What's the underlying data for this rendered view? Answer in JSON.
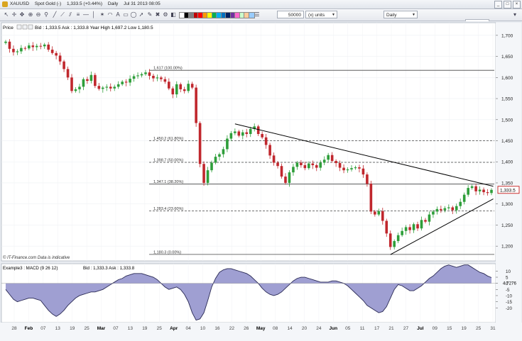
{
  "header": {
    "symbol": "XAUUSD",
    "name": "Spot Gold (-)",
    "price": "1,333.5 (+0.44%)",
    "period": "Daily",
    "datetime": "Jul 31 2013 08:05"
  },
  "toolbar": {
    "quantity": "50000",
    "units": "(x) units",
    "timeframe": "Daily",
    "swatch_colors": [
      "#ffffff",
      "#000000",
      "#7f7f7f",
      "#c00000",
      "#ff0000",
      "#ff9900",
      "#ffff00",
      "#00b050",
      "#00b0f0",
      "#0070c0",
      "#002060",
      "#7030a0",
      "#ff66cc",
      "#ccffcc",
      "#ffcc99",
      "#99ccff"
    ]
  },
  "price_panel": {
    "label": "Price",
    "info": "Bid : 1,333.5 Ask : 1,333.8 Year High 1,697.2 Low 1,180.5",
    "source": "© IT-Finance.com Data is indicative",
    "last_price": "1,333.5"
  },
  "macd_panel": {
    "label": "Example3 : MACD (9 26 12)",
    "info": "Bid : 1,333.3 Ask : 1,333.8",
    "last_value": "4.7276"
  },
  "colors": {
    "up": "#2e9e3a",
    "down": "#c0272d",
    "macd_fill": "#9f9fd2",
    "macd_line": "#2a2a55",
    "accent": "#d9a520"
  },
  "chart_data": {
    "type": "candlestick",
    "y_ticks": [
      1200,
      1250,
      1300,
      1350,
      1400,
      1450,
      1500,
      1550,
      1600,
      1650,
      1700
    ],
    "y_tick_labels": [
      "1,200",
      "1,250",
      "1,300",
      "1,350",
      "1,400",
      "1,450",
      "1,500",
      "1,550",
      "1,600",
      "1,650",
      "1,700"
    ],
    "ylim": [
      1165,
      1730
    ],
    "x_labels": [
      "28",
      "Feb",
      "07",
      "13",
      "19",
      "25",
      "Mar",
      "07",
      "13",
      "19",
      "25",
      "Apr",
      "04",
      "10",
      "16",
      "22",
      "26",
      "May",
      "08",
      "14",
      "20",
      "24",
      "Jun",
      "05",
      "11",
      "17",
      "21",
      "27",
      "Jul",
      "09",
      "15",
      "19",
      "25",
      "31"
    ],
    "x_months": [
      "Feb",
      "Mar",
      "Apr",
      "May",
      "Jun",
      "Jul"
    ],
    "fib_levels": [
      {
        "value": 1617,
        "label": "1,617 (100.00%)",
        "style": "solid"
      },
      {
        "value": 1450.2,
        "label": "1,450.2 (61.80%)",
        "style": "dashed"
      },
      {
        "value": 1398.7,
        "label": "1,398.7 (50.00%)",
        "style": "dashed"
      },
      {
        "value": 1347.1,
        "label": "1,347.1 (38.20%)",
        "style": "solid"
      },
      {
        "value": 1283.4,
        "label": "1,283.4 (23.60%)",
        "style": "dashed"
      },
      {
        "value": 1180.3,
        "label": "1,180.3 (0.00%)",
        "style": "solid"
      }
    ],
    "trendlines": [
      {
        "from": [
          59,
          1490
        ],
        "to": [
          124,
          1345
        ]
      },
      {
        "from": [
          99,
          1180
        ],
        "to": [
          124,
          1315
        ]
      }
    ],
    "closes": [
      1685,
      1668,
      1660,
      1662,
      1670,
      1669,
      1676,
      1672,
      1675,
      1674,
      1678,
      1666,
      1658,
      1652,
      1638,
      1620,
      1600,
      1568,
      1572,
      1578,
      1596,
      1592,
      1606,
      1580,
      1573,
      1576,
      1578,
      1574,
      1578,
      1584,
      1590,
      1588,
      1597,
      1603,
      1605,
      1608,
      1612,
      1604,
      1598,
      1600,
      1596,
      1590,
      1574,
      1560,
      1584,
      1572,
      1568,
      1585,
      1576,
      1492,
      1395,
      1350,
      1380,
      1398,
      1412,
      1418,
      1430,
      1455,
      1468,
      1472,
      1462,
      1470,
      1466,
      1478,
      1484,
      1466,
      1458,
      1440,
      1415,
      1398,
      1390,
      1365,
      1350,
      1375,
      1388,
      1398,
      1392,
      1385,
      1396,
      1392,
      1386,
      1398,
      1405,
      1416,
      1402,
      1397,
      1386,
      1380,
      1382,
      1385,
      1387,
      1384,
      1370,
      1348,
      1282,
      1275,
      1283,
      1260,
      1230,
      1198,
      1212,
      1226,
      1236,
      1245,
      1238,
      1252,
      1242,
      1262,
      1258,
      1275,
      1282,
      1288,
      1285,
      1290,
      1292,
      1285,
      1295,
      1305,
      1322,
      1338,
      1342,
      1330,
      1334,
      1328,
      1326,
      1333.5
    ],
    "macd": [
      -5,
      -9,
      -13,
      -15,
      -14,
      -13,
      -12,
      -12,
      -13,
      -14,
      -18,
      -22,
      -25,
      -27,
      -25,
      -22,
      -18,
      -15,
      -12,
      -10,
      -9,
      -8,
      -7,
      -7,
      -6,
      -5,
      -3,
      -1,
      1,
      3,
      4,
      6,
      7,
      8,
      8,
      8,
      7,
      6,
      5,
      3,
      0,
      -3,
      -5,
      -4,
      -3,
      -5,
      -9,
      -15,
      -24,
      -30,
      -29,
      -24,
      -14,
      -3,
      4,
      9,
      11,
      12,
      12,
      11,
      10,
      9,
      8,
      6,
      3,
      0,
      -4,
      -7,
      -9,
      -10,
      -9,
      -7,
      -4,
      -1,
      2,
      4,
      5,
      5,
      4,
      3,
      2,
      1,
      1,
      1,
      2,
      2,
      1,
      0,
      -2,
      -5,
      -8,
      -11,
      -14,
      -18,
      -20,
      -22,
      -24,
      -23,
      -19,
      -12,
      -5,
      -1,
      -2,
      -4,
      -6,
      -6,
      -4,
      -2,
      1,
      4,
      6,
      9,
      12,
      14,
      15,
      14,
      13,
      14,
      15,
      15,
      13,
      11,
      9,
      8,
      6,
      4.7276
    ],
    "macd_ticks": [
      10,
      5,
      0,
      -5,
      -10,
      -15,
      -20
    ],
    "macd_ylim": [
      -32,
      16
    ]
  }
}
